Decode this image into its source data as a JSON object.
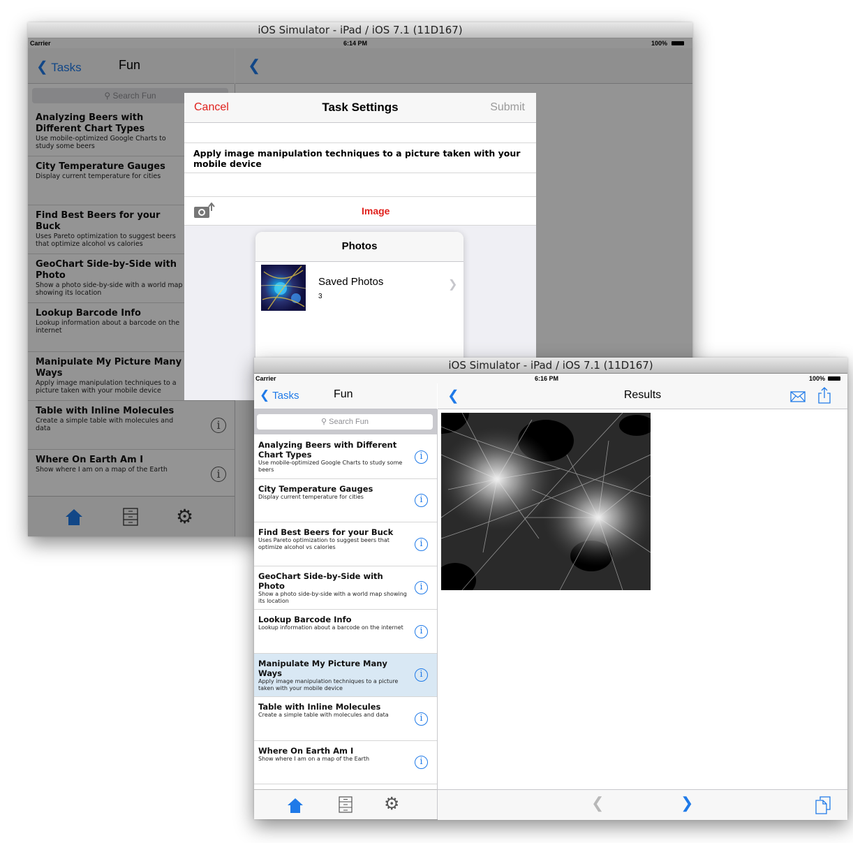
{
  "back_window": {
    "title": "iOS Simulator - iPad / iOS 7.1 (11D167)",
    "status": {
      "carrier": "Carrier",
      "time": "6:14 PM",
      "battery": "100%"
    },
    "nav": {
      "back_label": "Tasks",
      "title": "Fun"
    },
    "search_placeholder": "Search Fun",
    "items": [
      {
        "title": "Analyzing Beers with Different Chart Types",
        "subtitle": "Use mobile-optimized Google Charts to study some beers"
      },
      {
        "title": "City Temperature Gauges",
        "subtitle": "Display current temperature for cities"
      },
      {
        "title": "Find Best Beers for your Buck",
        "subtitle": "Uses Pareto optimization to suggest beers that optimize alcohol vs calories"
      },
      {
        "title": "GeoChart Side-by-Side with Photo",
        "subtitle": "Show a photo side-by-side with a world map showing its location"
      },
      {
        "title": "Lookup Barcode Info",
        "subtitle": "Lookup information about a barcode on the internet"
      },
      {
        "title": "Manipulate My Picture Many Ways",
        "subtitle": "Apply image manipulation techniques to a picture taken with your mobile device"
      },
      {
        "title": "Table with Inline Molecules",
        "subtitle": "Create a simple table with molecules and data"
      },
      {
        "title": "Where On Earth Am I",
        "subtitle": "Show where I am on a map of the Earth"
      }
    ],
    "info_glyph": "i",
    "modal": {
      "cancel_label": "Cancel",
      "title": "Task Settings",
      "submit_label": "Submit",
      "description": "Apply image manipulation techniques to a picture taken with your mobile device",
      "image_label": "Image",
      "popover": {
        "title": "Photos",
        "album_name": "Saved Photos",
        "album_count": "3"
      }
    }
  },
  "front_window": {
    "title": "iOS Simulator - iPad / iOS 7.1 (11D167)",
    "status": {
      "carrier": "Carrier",
      "time": "6:16 PM",
      "battery": "100%"
    },
    "nav": {
      "back_label": "Tasks",
      "title": "Fun"
    },
    "detail": {
      "title": "Results"
    },
    "search_placeholder": "Search Fun",
    "selected_index": 5,
    "items": [
      {
        "title": "Analyzing Beers with Different Chart Types",
        "subtitle": "Use mobile-optimized Google Charts to study some beers"
      },
      {
        "title": "City Temperature Gauges",
        "subtitle": "Display current temperature for cities"
      },
      {
        "title": "Find Best Beers for your Buck",
        "subtitle": "Uses Pareto optimization to suggest beers that optimize alcohol vs calories"
      },
      {
        "title": "GeoChart Side-by-Side with Photo",
        "subtitle": "Show a photo side-by-side with a world map showing its location"
      },
      {
        "title": "Lookup Barcode Info",
        "subtitle": "Lookup information about a barcode on the internet"
      },
      {
        "title": "Manipulate My Picture Many Ways",
        "subtitle": "Apply image manipulation techniques to a picture taken with your mobile device"
      },
      {
        "title": "Table with Inline Molecules",
        "subtitle": "Create a simple table with molecules and data"
      },
      {
        "title": "Where On Earth Am I",
        "subtitle": "Show where I am on a map of the Earth"
      }
    ],
    "info_glyph": "i"
  },
  "colors": {
    "accent": "#1f7ae8",
    "destructive": "#e0201c",
    "selected_row": "#d9e8f4"
  },
  "icons": [
    "chevron-left-icon",
    "search-icon",
    "info-icon",
    "home-icon",
    "cabinet-icon",
    "gear-icon",
    "camera-icon",
    "chevron-right-icon",
    "mail-icon",
    "share-icon",
    "pages-icon"
  ]
}
